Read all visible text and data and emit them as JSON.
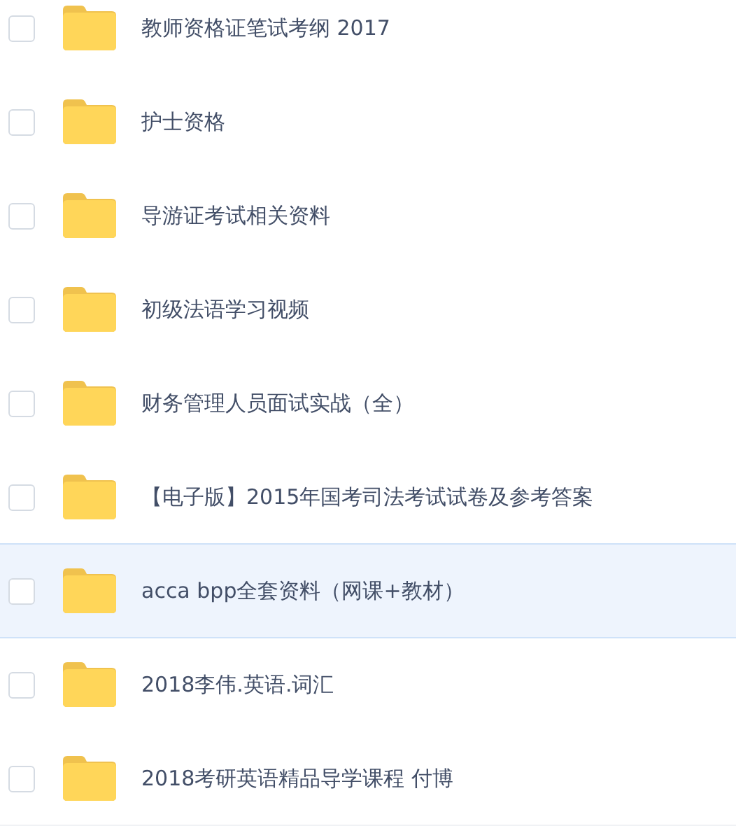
{
  "files": [
    {
      "name": "教师资格证笔试考纲 2017",
      "checked": false,
      "highlighted": false
    },
    {
      "name": "护士资格",
      "checked": false,
      "highlighted": false
    },
    {
      "name": "导游证考试相关资料",
      "checked": false,
      "highlighted": false
    },
    {
      "name": "初级法语学习视频",
      "checked": false,
      "highlighted": false
    },
    {
      "name": "财务管理人员面试实战（全）",
      "checked": false,
      "highlighted": false
    },
    {
      "name": "【电子版】2015年国考司法考试试卷及参考答案",
      "checked": false,
      "highlighted": false
    },
    {
      "name": "acca bpp全套资料（网课+教材）",
      "checked": false,
      "highlighted": true
    },
    {
      "name": "2018李伟.英语.词汇",
      "checked": false,
      "highlighted": false
    },
    {
      "name": "2018考研英语精品导学课程 付博",
      "checked": false,
      "highlighted": false
    }
  ]
}
